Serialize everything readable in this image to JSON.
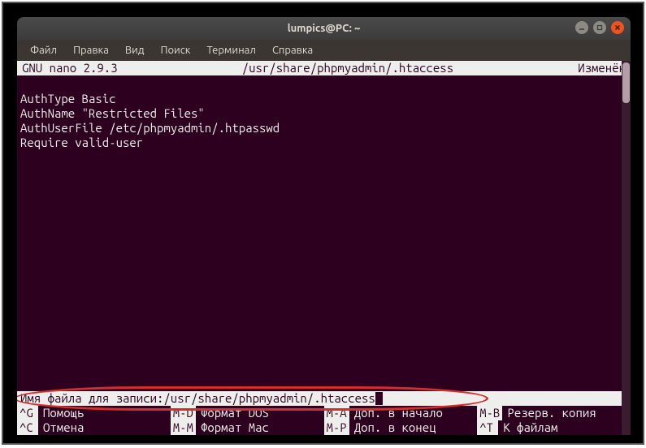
{
  "window": {
    "title": "lumpics@PC: ~"
  },
  "menubar": {
    "items": [
      "Файл",
      "Правка",
      "Вид",
      "Поиск",
      "Терминал",
      "Справка"
    ]
  },
  "nano": {
    "version": "GNU nano 2.9.3",
    "filepath": "/usr/share/phpmyadmin/.htaccess",
    "status": "Изменён",
    "content_lines": [
      "AuthType Basic",
      "AuthName \"Restricted Files\"",
      "AuthUserFile /etc/phpmyadmin/.htpasswd",
      "Require valid-user"
    ],
    "prompt_label": "Имя файла для записи: ",
    "prompt_value": "/usr/share/phpmyadmin/.htaccess",
    "shortcuts_row1": [
      {
        "key": "^G",
        "label": "Помощь"
      },
      {
        "key": "M-D",
        "label": "Формат DOS"
      },
      {
        "key": "M-A",
        "label": "Доп. в начало"
      },
      {
        "key": "M-B",
        "label": "Резерв. копия"
      }
    ],
    "shortcuts_row2": [
      {
        "key": "^C",
        "label": "Отмена"
      },
      {
        "key": "M-M",
        "label": "Формат Mac"
      },
      {
        "key": "M-P",
        "label": "Доп. в конец"
      },
      {
        "key": "^T",
        "label": "К файлам"
      }
    ]
  }
}
